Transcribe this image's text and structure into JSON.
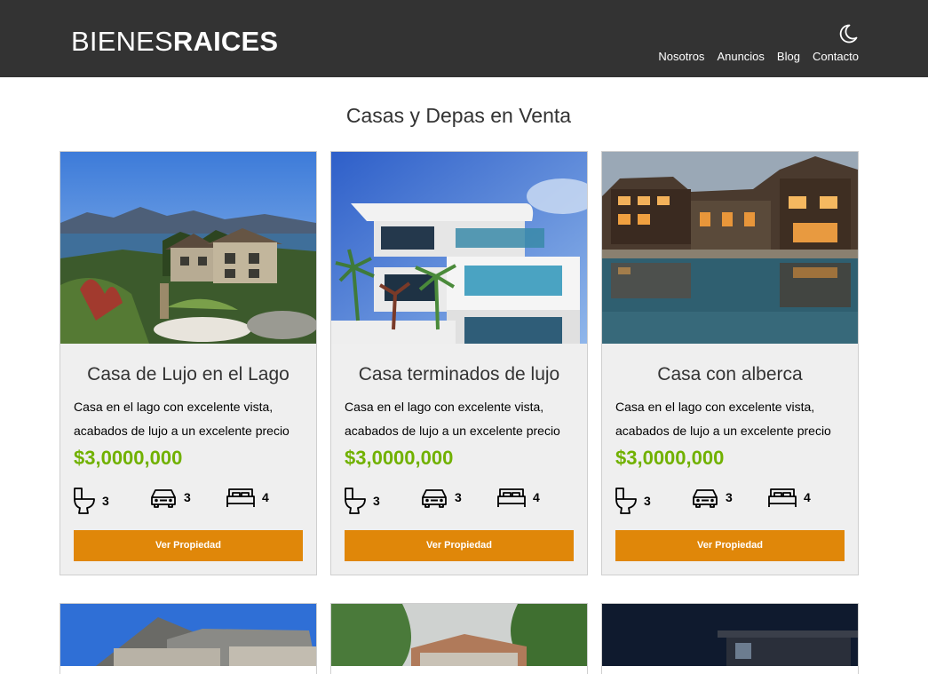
{
  "header": {
    "logo_light": "BIENES",
    "logo_bold": "RAICES",
    "nav": [
      "Nosotros",
      "Anuncios",
      "Blog",
      "Contacto"
    ],
    "theme_icon": "moon-icon"
  },
  "main": {
    "title": "Casas y Depas en Venta",
    "listings": [
      {
        "title": "Casa de Lujo en el Lago",
        "description": "Casa en el lago con excelente vista, acabados de lujo a un excelente precio",
        "price": "$3,0000,000",
        "bathrooms": "3",
        "parking": "3",
        "bedrooms": "4",
        "button": "Ver Propiedad"
      },
      {
        "title": "Casa terminados de lujo",
        "description": "Casa en el lago con excelente vista, acabados de lujo a un excelente precio",
        "price": "$3,0000,000",
        "bathrooms": "3",
        "parking": "3",
        "bedrooms": "4",
        "button": "Ver Propiedad"
      },
      {
        "title": "Casa con alberca",
        "description": "Casa en el lago con excelente vista, acabados de lujo a un excelente precio",
        "price": "$3,0000,000",
        "bathrooms": "3",
        "parking": "3",
        "bedrooms": "4",
        "button": "Ver Propiedad"
      }
    ]
  },
  "colors": {
    "header_bg": "#333333",
    "price": "#71b100",
    "button": "#e08709",
    "card_bg": "#efefef"
  },
  "icons": [
    "toilet-icon",
    "car-icon",
    "bed-icon"
  ]
}
